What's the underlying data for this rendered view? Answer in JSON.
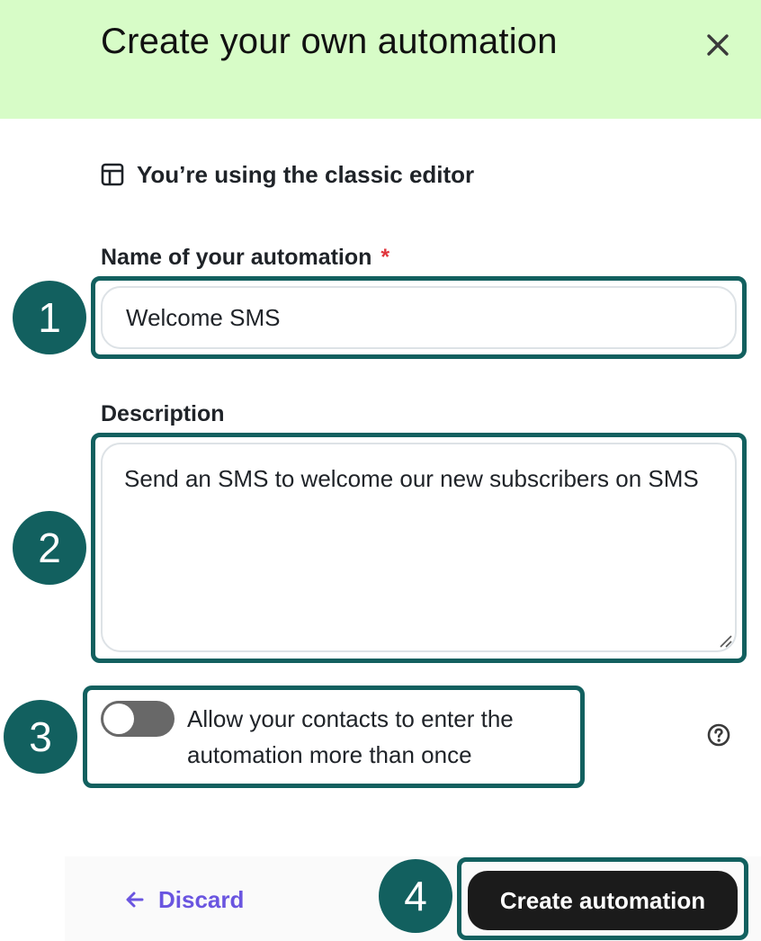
{
  "header": {
    "title": "Create your own automation",
    "close_icon": "close-icon"
  },
  "editor_note": {
    "icon": "layout-icon",
    "text": "You’re using the classic editor"
  },
  "name_field": {
    "label": "Name of your automation",
    "required_marker": "*",
    "value": "Welcome SMS"
  },
  "description_field": {
    "label": "Description",
    "value": "Send an SMS to welcome our new subscribers on SMS"
  },
  "reentry_toggle": {
    "label": "Allow your contacts to enter the automation more than once",
    "state": "off",
    "help_icon": "help-icon"
  },
  "footer": {
    "discard_label": "Discard",
    "discard_icon": "arrow-left-icon",
    "create_label": "Create automation"
  },
  "callouts": [
    "1",
    "2",
    "3",
    "4"
  ],
  "colors": {
    "header_bg": "#d7fcc7",
    "callout": "#12605f",
    "link": "#6a55e0",
    "primary_button": "#1b1b1b",
    "required": "#e0353c"
  }
}
